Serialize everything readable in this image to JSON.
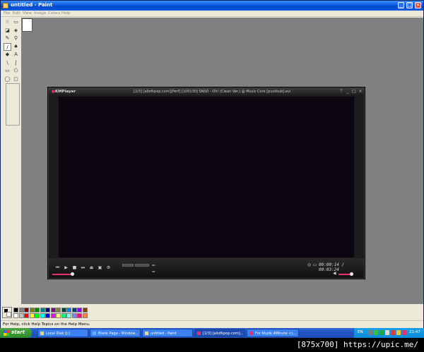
{
  "paint": {
    "title": "untitled - Paint",
    "window_buttons": [
      "_",
      "□",
      "×"
    ],
    "menu": [
      "File",
      "Edit",
      "View",
      "Image",
      "Colors",
      "Help"
    ],
    "tools": [
      {
        "name": "free-select-icon",
        "glyph": "☆"
      },
      {
        "name": "select-icon",
        "glyph": "▭"
      },
      {
        "name": "eraser-icon",
        "glyph": "◪"
      },
      {
        "name": "fill-icon",
        "glyph": "◈"
      },
      {
        "name": "pick-color-icon",
        "glyph": "✎"
      },
      {
        "name": "magnifier-icon",
        "glyph": "⚲"
      },
      {
        "name": "pencil-icon",
        "glyph": "/"
      },
      {
        "name": "brush-icon",
        "glyph": "♠"
      },
      {
        "name": "airbrush-icon",
        "glyph": "◆"
      },
      {
        "name": "text-icon",
        "glyph": "A"
      },
      {
        "name": "line-icon",
        "glyph": "\\"
      },
      {
        "name": "curve-icon",
        "glyph": "∫"
      },
      {
        "name": "rectangle-icon",
        "glyph": "▭"
      },
      {
        "name": "polygon-icon",
        "glyph": "⬠"
      },
      {
        "name": "ellipse-icon",
        "glyph": "◯"
      },
      {
        "name": "rounded-rect-icon",
        "glyph": "▢"
      }
    ],
    "palette_colors": [
      "#000000",
      "#808080",
      "#800000",
      "#808000",
      "#008000",
      "#008080",
      "#000080",
      "#800080",
      "#808040",
      "#004040",
      "#0080ff",
      "#004080",
      "#8000ff",
      "#804000",
      "#ffffff",
      "#c0c0c0",
      "#ff0000",
      "#ffff00",
      "#00ff00",
      "#00ffff",
      "#0000ff",
      "#ff00ff",
      "#ffff80",
      "#00ff80",
      "#80ffff",
      "#8080ff",
      "#ff0080",
      "#ff8040"
    ],
    "status": "For Help, click Help Topics on the Help Menu."
  },
  "kmplayer": {
    "logo": "KMPlayer",
    "title": "[2/3] [allofkpop.com][Perf] [100130] SNSD - Oh! (Clean Ver.) @ Music Core [puckkub].avi",
    "time": "00:00:14 / 00:03:24",
    "accent": "#e8306c"
  },
  "taskbar": {
    "start_label": "start",
    "tasks": [
      {
        "label": "Local Disk (J:)"
      },
      {
        "label": "Blank Page - Window..."
      },
      {
        "label": "untitled - Paint"
      },
      {
        "label": "[2/3] [allofkpop.com]..."
      },
      {
        "label": "For Muzik 4Minute <)..."
      }
    ],
    "lang": "EN",
    "clock": "21:47"
  },
  "watermark": "[875x700] https://upic.me/"
}
